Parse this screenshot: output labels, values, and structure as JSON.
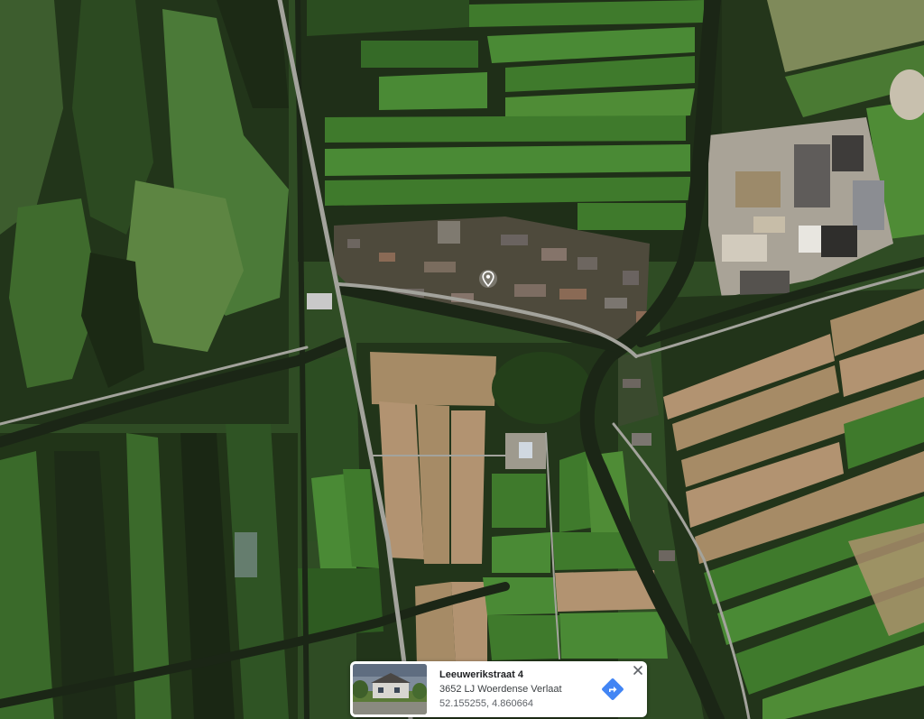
{
  "map": {
    "view": "satellite",
    "colors": {
      "water": "#1e2818",
      "grass": "#3f7a2c",
      "grass_light": "#4f8c36",
      "grass_dark": "#2e5b21",
      "field_tan": "#a68b66",
      "trees": "#24401a",
      "roof": "#6b6460",
      "road": "#9a9a92",
      "industrial": "#bdb6a8"
    }
  },
  "pin": {
    "icon": "location-pin-icon"
  },
  "info_card": {
    "title": "Leeuwerikstraat 4",
    "address": "3652 LJ Woerdense Verlaat",
    "coordinates": "52.155255, 4.860664",
    "thumbnail_icon": "street-view-thumbnail",
    "directions_icon": "directions-icon",
    "close_icon": "close-icon",
    "accent_color": "#4285f4"
  }
}
